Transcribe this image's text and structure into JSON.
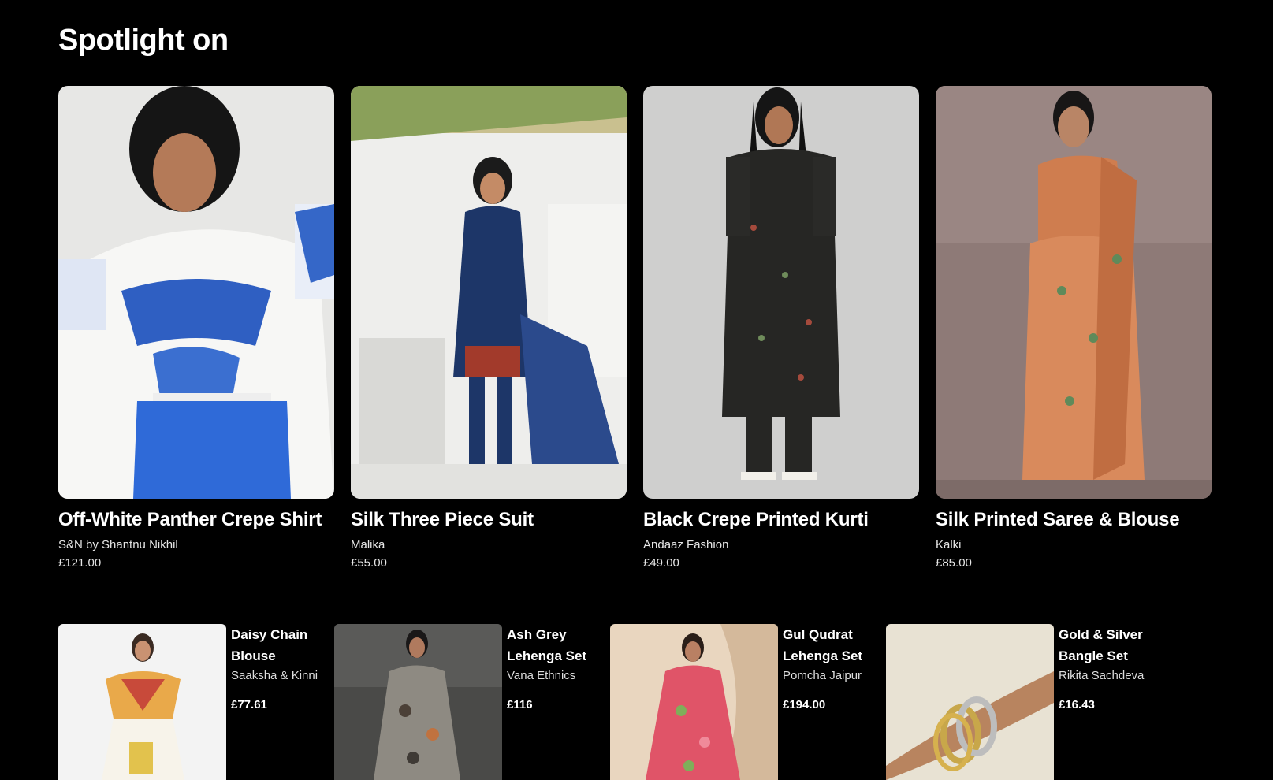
{
  "section": {
    "title": "Spotlight on"
  },
  "spotlight": [
    {
      "title": "Off-White Panther Crepe Shirt",
      "brand": "S&N by Shantnu Nikhil",
      "price": "£121.00",
      "image": "off-white-blue-printed-shirt"
    },
    {
      "title": "Silk Three Piece Suit",
      "brand": "Malika",
      "price": "£55.00",
      "image": "navy-three-piece-suit"
    },
    {
      "title": "Black Crepe Printed Kurti",
      "brand": "Andaaz Fashion",
      "price": "£49.00",
      "image": "black-printed-kurti"
    },
    {
      "title": "Silk Printed Saree & Blouse",
      "brand": "Kalki",
      "price": "£85.00",
      "image": "orange-printed-saree"
    }
  ],
  "more_products": [
    {
      "title": "Daisy Chain Blouse",
      "brand": "Saaksha & Kinni",
      "price": "£77.61",
      "image": "multicolor-blouse-skirt"
    },
    {
      "title": "Ash Grey Lehenga Set",
      "brand": "Vana Ethnics",
      "price": "£116",
      "image": "grey-floral-lehenga"
    },
    {
      "title": "Gul Qudrat Lehenga Set",
      "brand": "Pomcha Jaipur",
      "price": "£194.00",
      "image": "pink-floral-lehenga"
    },
    {
      "title": "Gold & Silver Bangle Set",
      "brand": "Rikita Sachdeva",
      "price": "£16.43",
      "image": "gold-silver-bangles"
    }
  ],
  "colors": {
    "background": "#000000",
    "text": "#ffffff",
    "muted_text": "#e6e6e6"
  }
}
